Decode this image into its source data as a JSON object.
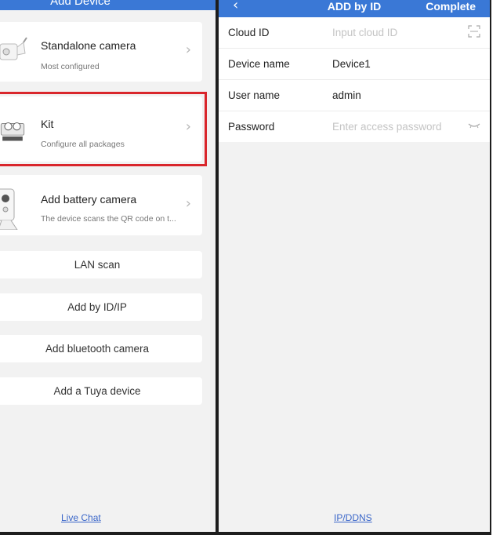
{
  "left": {
    "header_title": "Add Device",
    "cards": [
      {
        "title": "Standalone camera",
        "subtitle": "Most configured",
        "icon": "camera-icon"
      },
      {
        "title": "Kit",
        "subtitle": "Configure all packages",
        "icon": "kit-icon"
      },
      {
        "title": "Add battery camera",
        "subtitle": "The device scans the QR code on t...",
        "icon": "battery-camera-icon"
      }
    ],
    "buttons": [
      "LAN scan",
      "Add by ID/IP",
      "Add bluetooth camera",
      "Add a Tuya device"
    ],
    "footer_link": "Live Chat",
    "chevron": "›"
  },
  "right": {
    "back": "‹",
    "title": "ADD by ID",
    "complete": "Complete",
    "fields": [
      {
        "label": "Cloud ID",
        "value": "",
        "placeholder": "Input cloud ID",
        "icon": "scan-icon"
      },
      {
        "label": "Device name",
        "value": "Device1",
        "placeholder": ""
      },
      {
        "label": "User name",
        "value": "admin",
        "placeholder": ""
      },
      {
        "label": "Password",
        "value": "",
        "placeholder": "Enter access password",
        "icon": "eye-closed-icon"
      }
    ],
    "footer_link": "IP/DDNS"
  },
  "colors": {
    "primary": "#3a78d6",
    "highlight": "#d9262c",
    "background": "#f2f2f2",
    "link": "#3a66c9"
  }
}
